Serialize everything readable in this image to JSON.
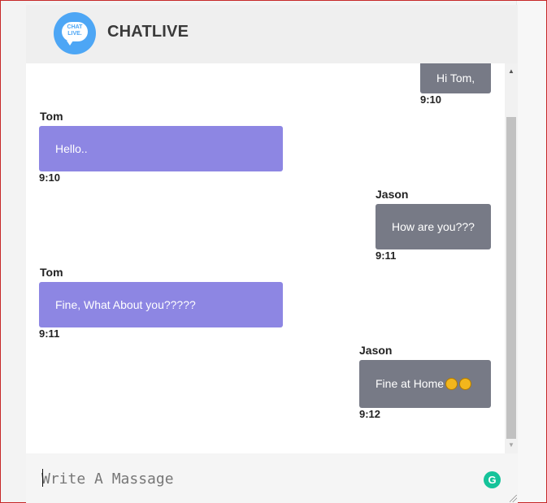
{
  "app": {
    "title": "CHATLIVE",
    "logo_text_line1": "CHAT",
    "logo_text_line2": "LIVE."
  },
  "messages": [
    {
      "sender": "",
      "text": "Hi Tom,",
      "time": "9:10",
      "side": "right"
    },
    {
      "sender": "Tom",
      "text": "Hello..",
      "time": "9:10",
      "side": "left"
    },
    {
      "sender": "Jason",
      "text": "How are you???",
      "time": "9:11",
      "side": "right"
    },
    {
      "sender": "Tom",
      "text": "Fine, What About you?????",
      "time": "9:11",
      "side": "left"
    },
    {
      "sender": "Jason",
      "text": "Fine at Home",
      "time": "9:12",
      "side": "right",
      "emoji_count": 2
    }
  ],
  "composer": {
    "placeholder": "Write A Massage"
  },
  "icons": {
    "logo": "chatlive-logo-icon",
    "grammarly": "grammarly-icon",
    "emoji": "grinning-face-icon",
    "scroll_up": "scroll-up-arrow-icon",
    "scroll_down": "scroll-down-arrow-icon"
  },
  "colors": {
    "tom_bubble": "#8d86e3",
    "jason_bubble": "#777a86",
    "logo_blue": "#4da6f5",
    "grammarly_green": "#15c39a"
  }
}
